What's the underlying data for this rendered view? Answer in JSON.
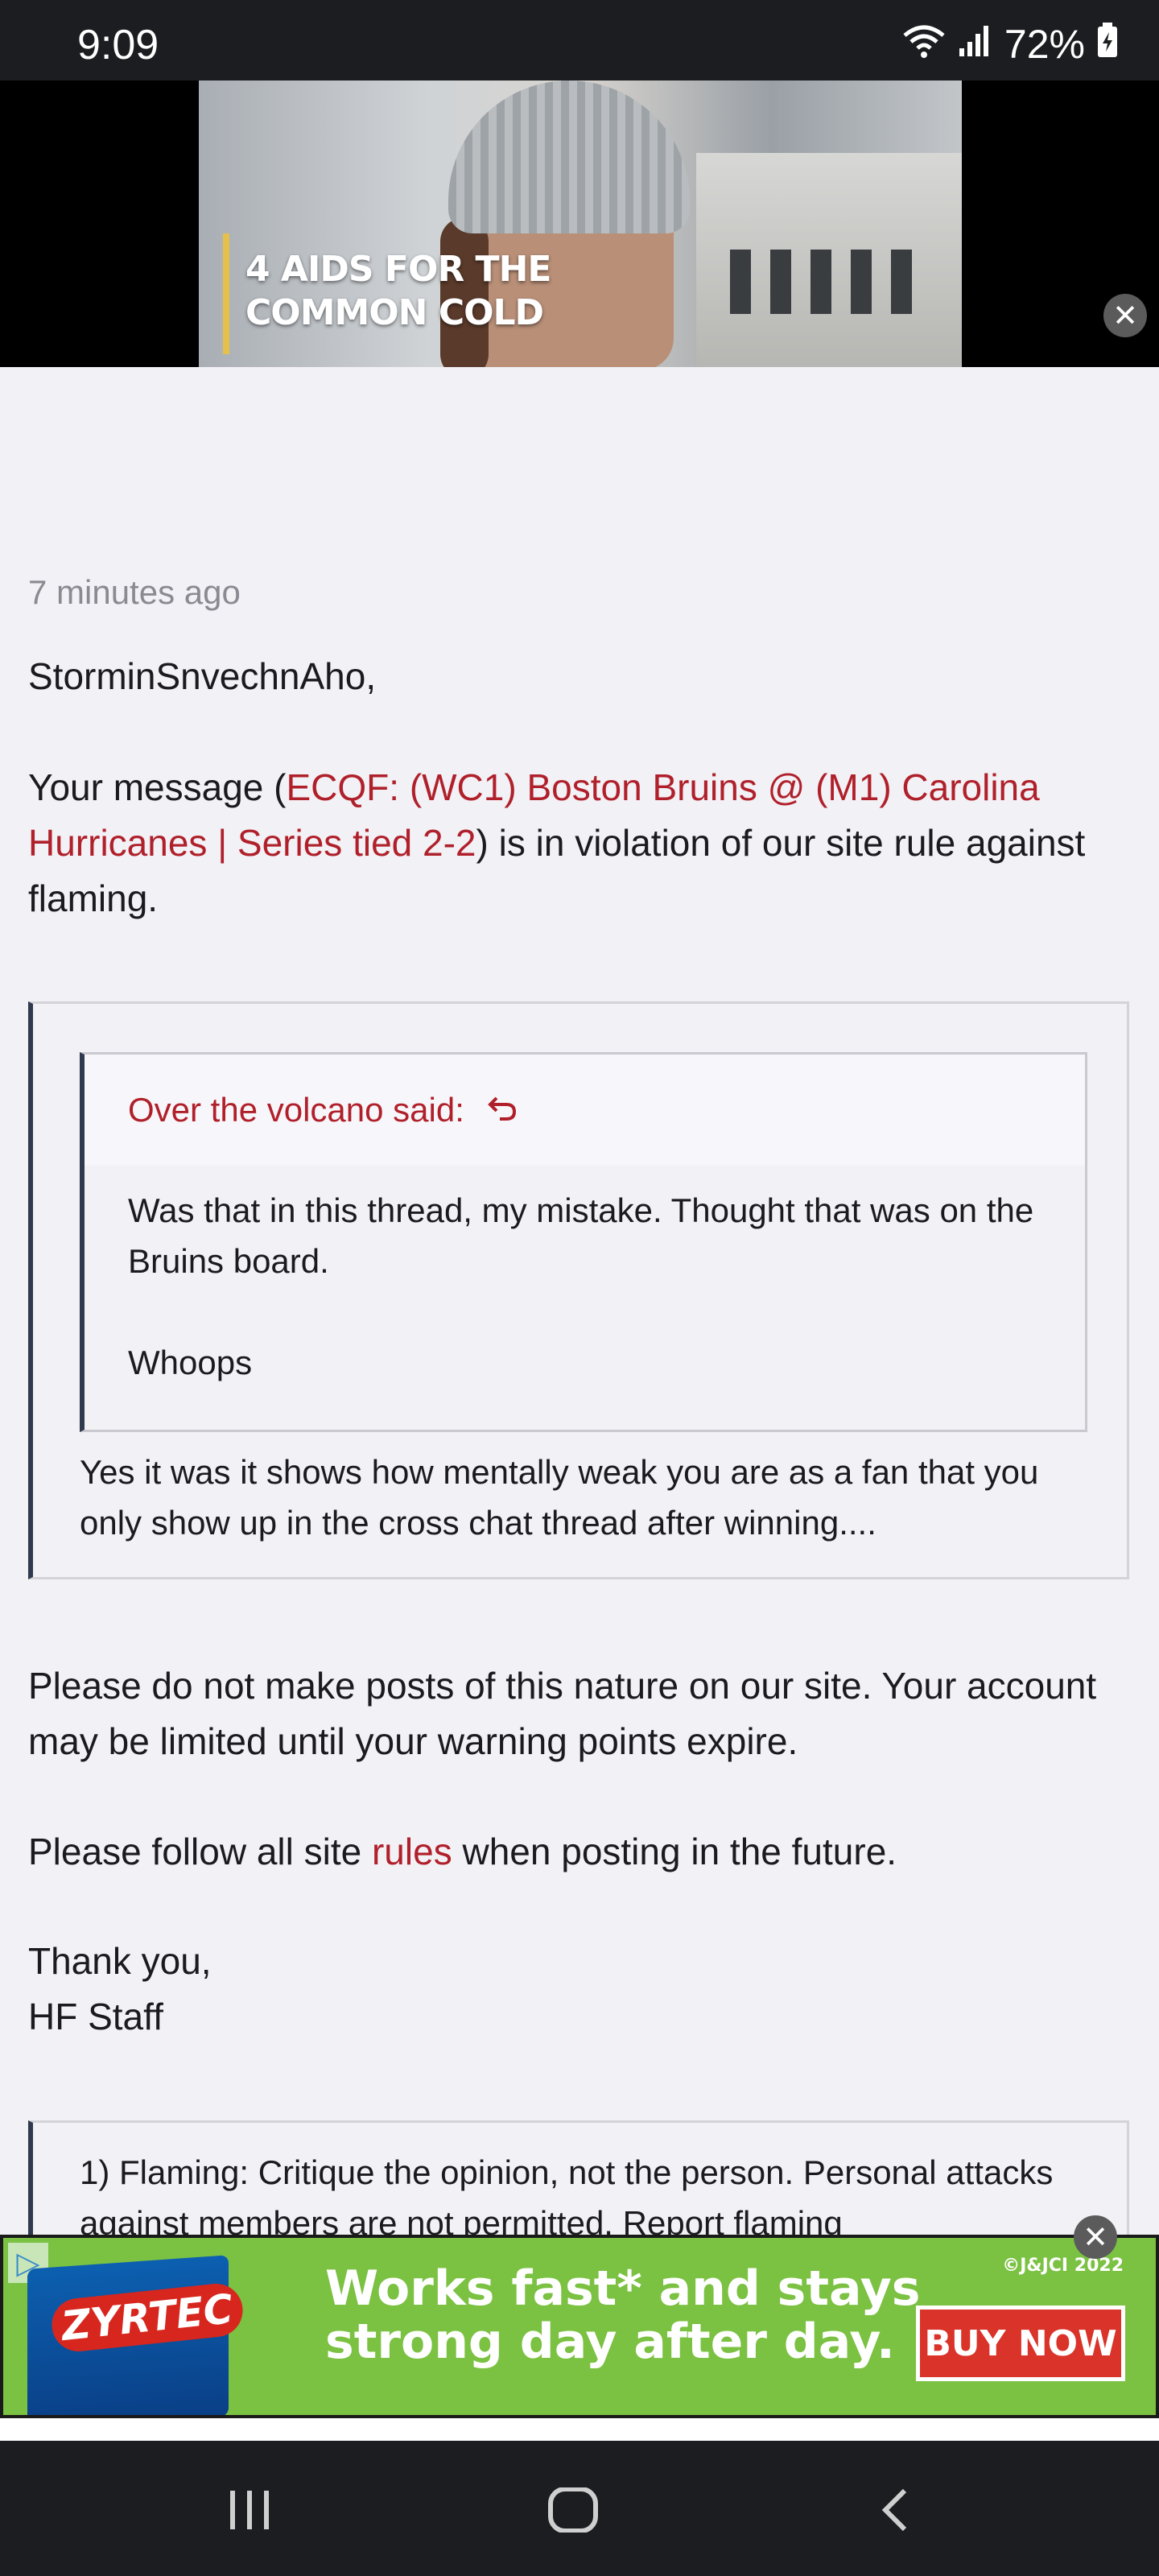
{
  "status_bar": {
    "time": "9:09",
    "battery": "72%"
  },
  "video_ad": {
    "caption_line1": "4 AIDS FOR THE",
    "caption_line2": "COMMON COLD"
  },
  "message": {
    "timestamp": "7 minutes ago",
    "greeting": "StorminSnvechnAho,",
    "intro_prefix": "Your message (",
    "thread_link": "ECQF: (WC1) Boston Bruins @ (M1) Carolina Hurricanes | Series tied 2-2",
    "intro_suffix": ") is in violation of our site rule against flaming.",
    "quote": {
      "inner_author": "Over the volcano said:",
      "inner_line1": "Was that in this thread, my mistake. Thought that was on the Bruins board.",
      "inner_line2": "Whoops",
      "reply": "Yes it was it shows how mentally weak you are as a fan that you only show up in the cross chat thread after winning...."
    },
    "warning": "Please do not make posts of this nature on our site. Your account may be limited until your warning points expire.",
    "follow_prefix": "Please follow all site ",
    "rules_link": "rules",
    "follow_suffix": " when posting in the future.",
    "thanks": "Thank you,",
    "signature": "HF Staff",
    "rule_text": "1) Flaming: Critique the opinion, not the person. Personal attacks against members are not permitted. Report flaming"
  },
  "bottom_ad": {
    "headline_line1": "Works fast* and stays",
    "headline_line2": "strong day after day.",
    "cta": "BUY NOW",
    "copyright": "©J&JCI 2022",
    "brand": "ZYRTEC"
  },
  "colors": {
    "link": "#b0202a",
    "ad_green": "#7bc142",
    "quote_bar": "#2f3a4e"
  }
}
